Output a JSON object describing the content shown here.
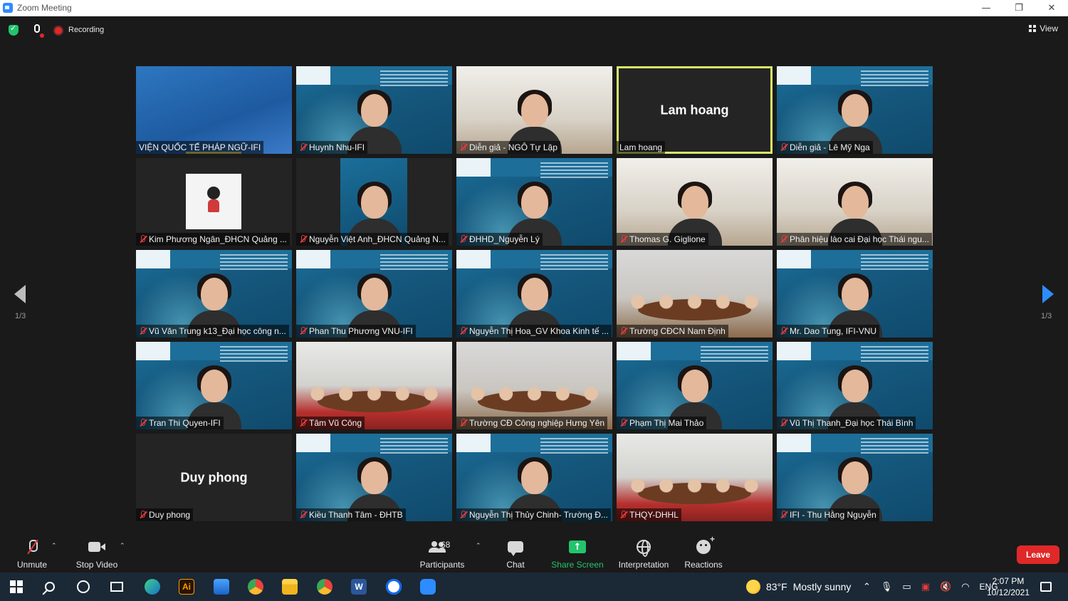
{
  "window": {
    "title": "Zoom Meeting",
    "controls": [
      "—",
      "❐",
      "✕"
    ]
  },
  "topbar": {
    "recording_label": "Recording",
    "view_label": "View"
  },
  "pagination": {
    "left": "1/3",
    "right": "1/3"
  },
  "participants": [
    {
      "name": "VIỆN QUỐC TẾ PHÁP NGỮ-IFI",
      "muted": false,
      "style": "stage"
    },
    {
      "name": "Huynh Nhu-IFI",
      "muted": true,
      "style": "ifi"
    },
    {
      "name": "Diễn giả - NGÔ Tự Lập",
      "muted": true,
      "style": "office"
    },
    {
      "name": "Lam hoang",
      "muted": false,
      "style": "dark",
      "display_name": "Lam hoang",
      "active": true
    },
    {
      "name": "Diễn giả - Lê Mỹ Nga",
      "muted": true,
      "style": "ifi"
    },
    {
      "name": "Kim Phương Ngân_ĐHCN Quảng ...",
      "muted": true,
      "style": "avatar"
    },
    {
      "name": "Nguyễn Việt Anh_ĐHCN Quảng N...",
      "muted": true,
      "style": "inset"
    },
    {
      "name": "ĐHHD_Nguyễn Lý",
      "muted": true,
      "style": "ifi"
    },
    {
      "name": "Thomas G. Giglione",
      "muted": true,
      "style": "office"
    },
    {
      "name": "Phân hiệu lào cai Đại học Thái ngu...",
      "muted": true,
      "style": "office"
    },
    {
      "name": "Vũ Văn Trung k13_Đại học công n...",
      "muted": true,
      "style": "ifi"
    },
    {
      "name": "Phan Thu Phương VNU-IFI",
      "muted": true,
      "style": "ifi"
    },
    {
      "name": "Nguyễn Thị Hoa_GV Khoa Kinh tế ...",
      "muted": true,
      "style": "ifi"
    },
    {
      "name": "Trường CĐCN Nam Định",
      "muted": true,
      "style": "room"
    },
    {
      "name": "Mr. Dao Tung, IFI-VNU",
      "muted": true,
      "style": "ifi"
    },
    {
      "name": "Tran Thi Quyen-IFI",
      "muted": true,
      "style": "ifi"
    },
    {
      "name": "Tâm Vũ Công",
      "muted": true,
      "style": "room2"
    },
    {
      "name": "Trường CĐ Công nghiệp Hưng Yên",
      "muted": true,
      "style": "room"
    },
    {
      "name": "Phạm Thị Mai Thảo",
      "muted": true,
      "style": "ifi"
    },
    {
      "name": "Vũ Thị Thanh_Đại học Thái Bình",
      "muted": true,
      "style": "ifi"
    },
    {
      "name": "Duy phong",
      "muted": true,
      "style": "dark",
      "display_name": "Duy phong"
    },
    {
      "name": "Kiều Thanh Tâm - ĐHTB",
      "muted": true,
      "style": "ifi"
    },
    {
      "name": "Nguyễn Thị Thủy Chinh- Trường Đ...",
      "muted": true,
      "style": "ifi"
    },
    {
      "name": "THQY-DHHL",
      "muted": true,
      "style": "room2"
    },
    {
      "name": "IFI - Thu Hằng Nguyễn",
      "muted": true,
      "style": "ifi"
    }
  ],
  "toolbar": {
    "unmute": "Unmute",
    "stop_video": "Stop Video",
    "participants": "Participants",
    "participants_count": "68",
    "chat": "Chat",
    "share_screen": "Share Screen",
    "interpretation": "Interpretation",
    "reactions": "Reactions",
    "leave": "Leave"
  },
  "taskbar": {
    "weather_temp": "83°F",
    "weather_text": "Mostly sunny",
    "language": "ENG",
    "time": "2:07 PM",
    "date": "10/12/2021",
    "apps": [
      "edge",
      "illustrator",
      "mail",
      "chrome",
      "file-explorer",
      "chrome-profile",
      "word",
      "zalo",
      "zoom"
    ],
    "illustrator_label": "Ai",
    "word_label": "W"
  },
  "colors": {
    "accent": "#2d8cff",
    "leave": "#e02828",
    "share": "#23c46b",
    "active_speaker": "#d8e86a"
  }
}
